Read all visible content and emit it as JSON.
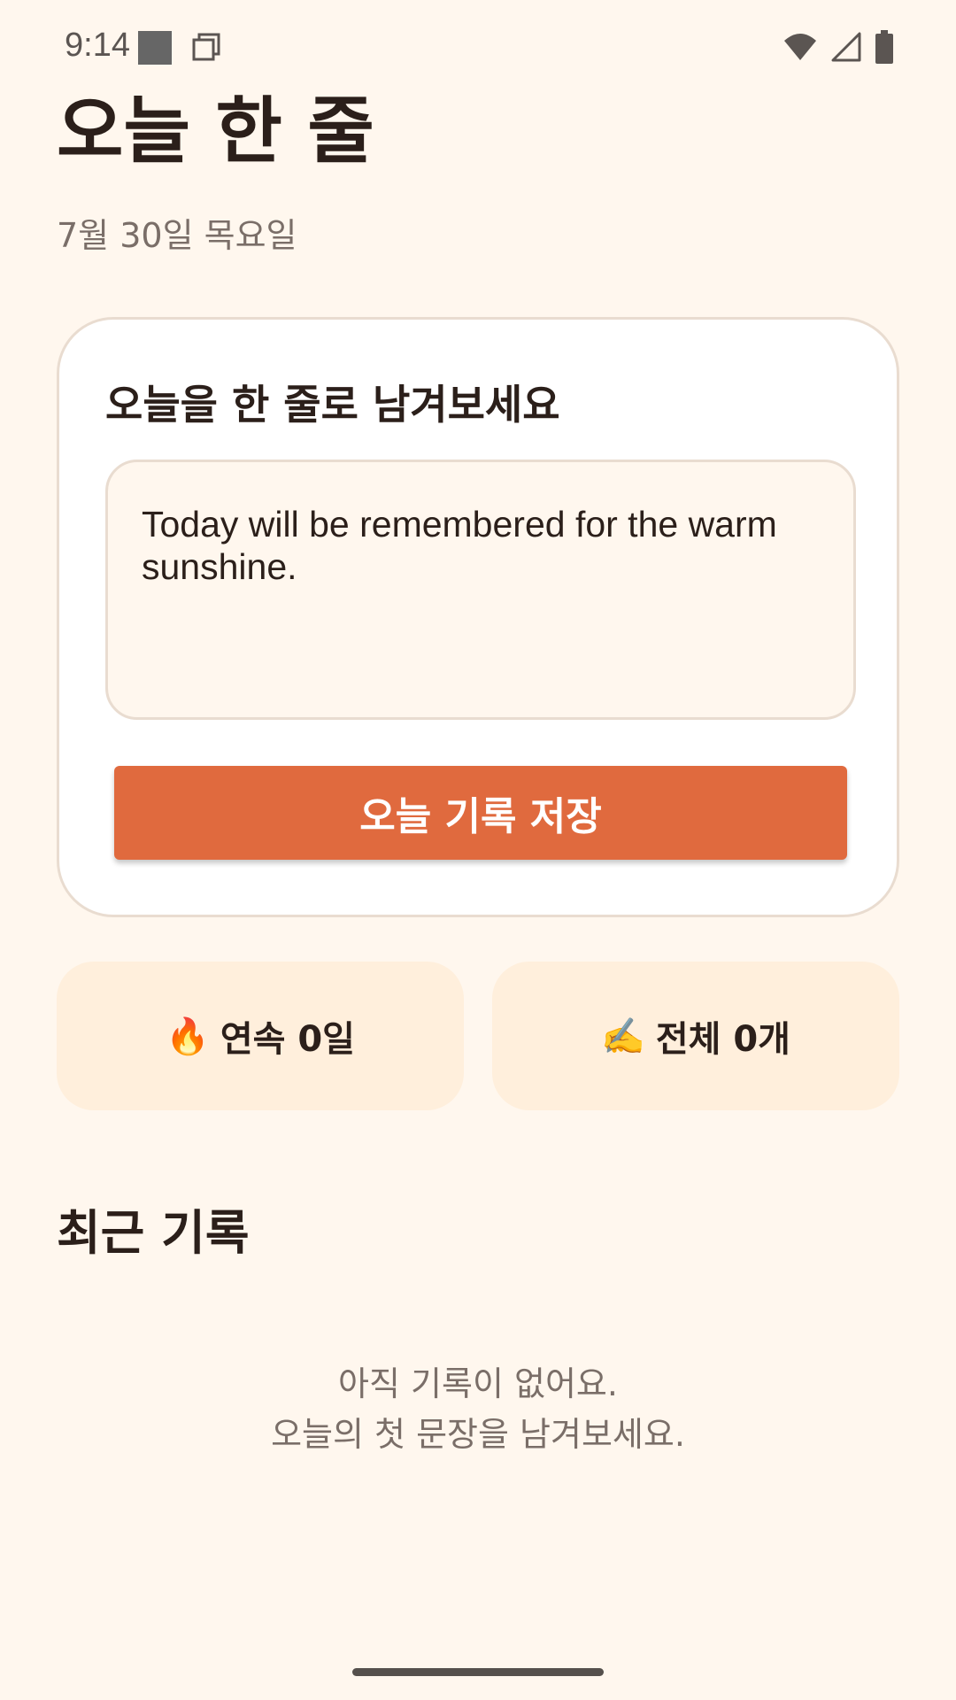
{
  "status_bar": {
    "time": "9:14",
    "icons": [
      "square-icon",
      "copy-icon",
      "wifi-icon",
      "signal-icon",
      "battery-icon"
    ]
  },
  "header": {
    "title": "오늘 한 줄",
    "date": "7월 30일 목요일"
  },
  "entry_card": {
    "prompt": "오늘을 한 줄로 남겨보세요",
    "input_value": "Today will be remembered for the warm sunshine.",
    "save_button_label": "오늘 기록 저장"
  },
  "stats": {
    "streak_icon": "🔥",
    "streak_label": "연속 0일",
    "total_icon": "✍️",
    "total_label": "전체 0개"
  },
  "recent": {
    "title": "최근 기록",
    "empty_line1": "아직 기록이 없어요.",
    "empty_line2": "오늘의 첫 문장을 남겨보세요."
  },
  "colors": {
    "background": "#FFF7EE",
    "accent": "#E06A3E",
    "stat_card": "#FFEFDC",
    "text": "#2B1F1A",
    "muted": "#7A6E68"
  }
}
